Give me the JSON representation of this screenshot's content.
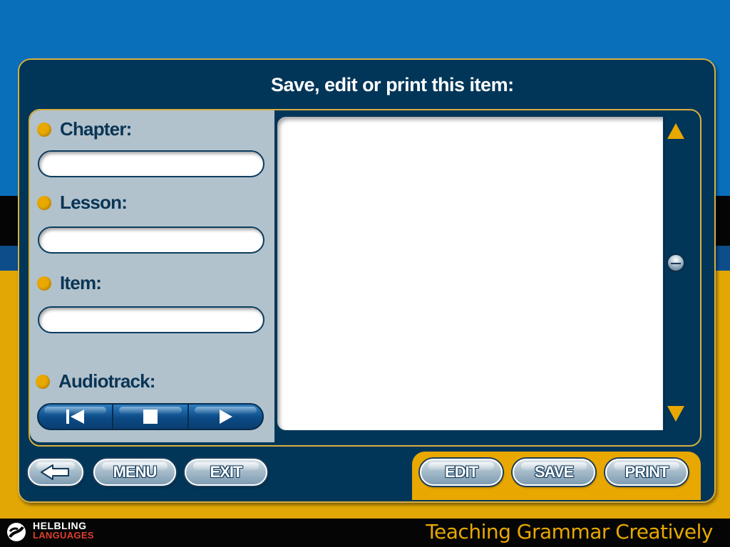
{
  "panel": {
    "title": "Save, edit or print this item:"
  },
  "fields": {
    "chapter": {
      "label": "Chapter:",
      "value": ""
    },
    "lesson": {
      "label": "Lesson:",
      "value": ""
    },
    "item": {
      "label": "Item:",
      "value": ""
    },
    "audiotrack": {
      "label": "Audiotrack:"
    }
  },
  "audio_controls": [
    {
      "name": "previous-track",
      "icon": "skip-back-icon"
    },
    {
      "name": "stop",
      "icon": "stop-icon"
    },
    {
      "name": "play",
      "icon": "play-icon"
    }
  ],
  "nav_buttons": {
    "back": {
      "icon": "arrow-left-icon"
    },
    "menu": "MENU",
    "exit": "EXIT"
  },
  "action_buttons": {
    "edit": "EDIT",
    "save": "SAVE",
    "print": "PRINT"
  },
  "footer": {
    "brand_top": "HELBLING",
    "brand_bottom": "LANGUAGES",
    "tagline": "Teaching Grammar Creatively"
  },
  "colors": {
    "accent_gold": "#e8a800",
    "panel_navy": "#013659",
    "field_panel": "#b2c2cc",
    "background_blue": "#0a6fba"
  }
}
